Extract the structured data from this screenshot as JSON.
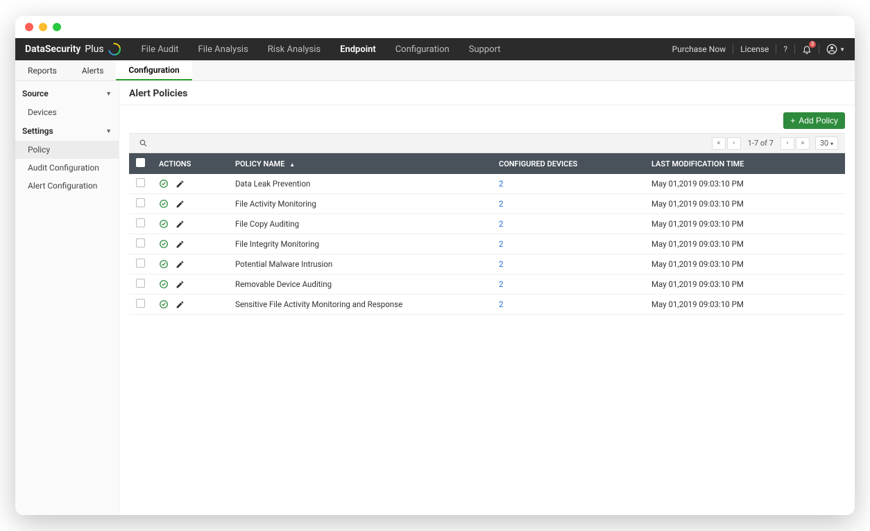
{
  "brand": {
    "name1": "DataSecurity",
    "name2": " Plus"
  },
  "topnav": {
    "items": [
      "File Audit",
      "File Analysis",
      "Risk Analysis",
      "Endpoint",
      "Configuration",
      "Support"
    ],
    "active_index": 3,
    "right": {
      "purchase": "Purchase Now",
      "license": "License",
      "badge": "3"
    }
  },
  "subnav": {
    "items": [
      "Reports",
      "Alerts",
      "Configuration"
    ],
    "active_index": 2
  },
  "sidebar": {
    "group1": {
      "label": "Source",
      "items": [
        "Devices"
      ]
    },
    "group2": {
      "label": "Settings",
      "items": [
        "Policy",
        "Audit Configuration",
        "Alert Configuration"
      ],
      "active_index": 0
    }
  },
  "page": {
    "title": "Alert Policies",
    "add_button": "Add Policy"
  },
  "table": {
    "headers": {
      "actions": "ACTIONS",
      "name": "POLICY NAME",
      "devices": "CONFIGURED DEVICES",
      "modified": "LAST MODIFICATION TIME"
    },
    "pagination": {
      "info": "1-7 of 7",
      "size": "30"
    },
    "rows": [
      {
        "name": "Data Leak Prevention",
        "devices": "2",
        "modified": "May 01,2019 09:03:10 PM"
      },
      {
        "name": "File Activity Monitoring",
        "devices": "2",
        "modified": "May 01,2019 09:03:10 PM"
      },
      {
        "name": "File Copy Auditing",
        "devices": "2",
        "modified": "May 01,2019 09:03:10 PM"
      },
      {
        "name": "File Integrity Monitoring",
        "devices": "2",
        "modified": "May 01,2019 09:03:10 PM"
      },
      {
        "name": "Potential Malware Intrusion",
        "devices": "2",
        "modified": "May 01,2019 09:03:10 PM"
      },
      {
        "name": "Removable Device Auditing",
        "devices": "2",
        "modified": "May 01,2019 09:03:10 PM"
      },
      {
        "name": "Sensitive File Activity Monitoring and Response",
        "devices": "2",
        "modified": "May 01,2019 09:03:10 PM"
      }
    ]
  }
}
